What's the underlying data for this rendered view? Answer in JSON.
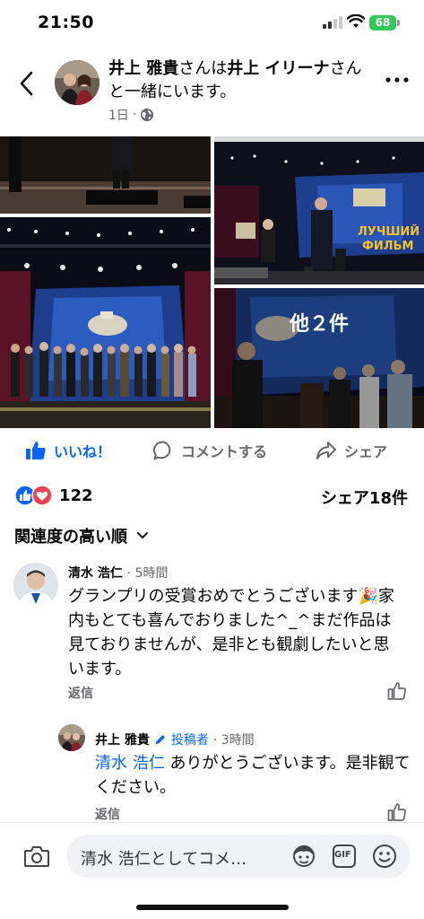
{
  "status": {
    "time": "21:50",
    "battery": "68"
  },
  "header": {
    "author": "井上 雅貴",
    "connector1": "さんは",
    "tagged": "井上 イリーナ",
    "connector2": "さんと一緒にいます。",
    "time": "1日",
    "separator": "·"
  },
  "photos": {
    "more_label": "他２件"
  },
  "actions": {
    "like": "いいね！",
    "comment": "コメントする",
    "share": "シェア"
  },
  "stats": {
    "reactions": "122",
    "shares": "シェア18件"
  },
  "sort": {
    "label": "関連度の高い順"
  },
  "comments": [
    {
      "name": "清水 浩仁",
      "time": "· 5時間",
      "text": "グランプリの受賞おめでとうございます🎉家内もとても喜んでおりました^_^まだ作品は見ておりませんが、是非とも観劇したいと思います。",
      "reply": "返信"
    },
    {
      "name": "井上 雅貴",
      "badge": "投稿者",
      "time": "· 3時間",
      "mention": "清水 浩仁",
      "text": " ありがとうございます。是非観てください。",
      "reply": "返信"
    }
  ],
  "composer": {
    "placeholder": "清水 浩仁としてコメ…",
    "gif": "GIF"
  },
  "colors": {
    "accent": "#0866ff",
    "muted": "#65676b",
    "battery": "#34c759"
  }
}
